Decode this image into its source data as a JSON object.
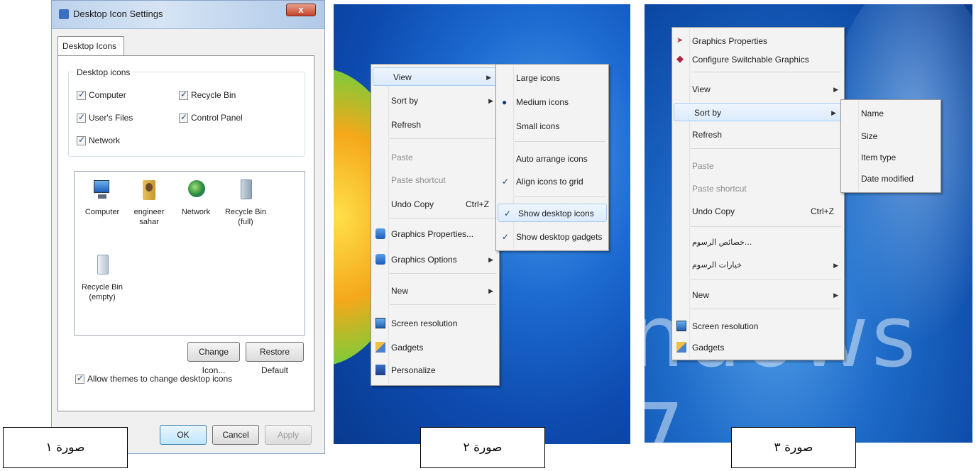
{
  "panel1": {
    "title": "Desktop Icon Settings",
    "close": "x",
    "tab": "Desktop Icons",
    "group_label": "Desktop icons",
    "checkboxes": [
      "Computer",
      "Recycle Bin",
      "User's Files",
      "Control Panel",
      "Network"
    ],
    "icons": [
      {
        "label": "Computer",
        "icon": "computer-icon"
      },
      {
        "label": "engineer sahar",
        "icon": "user-folder-icon"
      },
      {
        "label": "Network",
        "icon": "network-icon"
      },
      {
        "label": "Recycle Bin (full)",
        "icon": "recycle-bin-full-icon"
      },
      {
        "label": "Recycle Bin (empty)",
        "icon": "recycle-bin-empty-icon"
      }
    ],
    "change_icon": "Change Icon...",
    "restore_default": "Restore Default",
    "allow_themes": "Allow themes to change desktop icons",
    "ok": "OK",
    "cancel": "Cancel",
    "apply": "Apply"
  },
  "panel2": {
    "menu": [
      {
        "label": "View"
      },
      {
        "label": "Sort by"
      },
      {
        "label": "Refresh"
      },
      {
        "label": "Paste"
      },
      {
        "label": "Paste shortcut"
      },
      {
        "label": "Undo Copy",
        "shortcut": "Ctrl+Z"
      },
      {
        "label": "Graphics Properties..."
      },
      {
        "label": "Graphics Options"
      },
      {
        "label": "New"
      },
      {
        "label": "Screen resolution"
      },
      {
        "label": "Gadgets"
      },
      {
        "label": "Personalize"
      }
    ],
    "submenu": [
      {
        "label": "Large icons"
      },
      {
        "label": "Medium icons"
      },
      {
        "label": "Small icons"
      },
      {
        "label": "Auto arrange icons"
      },
      {
        "label": "Align icons to grid"
      },
      {
        "label": "Show desktop icons"
      },
      {
        "label": "Show desktop gadgets"
      }
    ]
  },
  "panel3": {
    "menu": [
      {
        "label": "Graphics Properties"
      },
      {
        "label": "Configure Switchable Graphics"
      },
      {
        "label": "View"
      },
      {
        "label": "Sort by"
      },
      {
        "label": "Refresh"
      },
      {
        "label": "Paste"
      },
      {
        "label": "Paste shortcut"
      },
      {
        "label": "Undo Copy",
        "shortcut": "Ctrl+Z"
      },
      {
        "label": "خصائص الرسوم..."
      },
      {
        "label": "خيارات الرسوم"
      },
      {
        "label": "New"
      },
      {
        "label": "Screen resolution"
      },
      {
        "label": "Gadgets"
      }
    ],
    "submenu": [
      {
        "label": "Name"
      },
      {
        "label": "Size"
      },
      {
        "label": "Item type"
      },
      {
        "label": "Date modified"
      }
    ],
    "wallpaper_text": "ndows 7"
  },
  "captions": [
    "صورة ١",
    "صورة ٢",
    "صورة ٣"
  ],
  "colors": {
    "desktop_blue": "#1c6ad0",
    "menu_bg": "#f3f3f3",
    "highlight": "#dcebfc"
  }
}
